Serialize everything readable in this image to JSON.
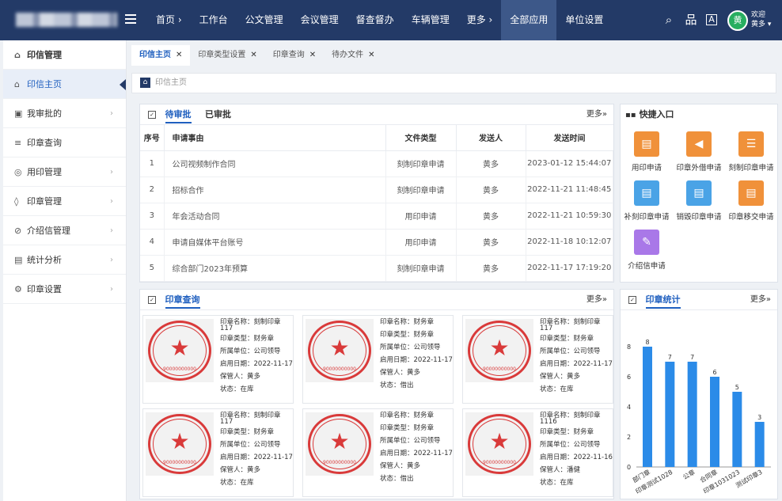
{
  "header": {
    "nav": [
      "首页 ›",
      "工作台",
      "公文管理",
      "会议管理",
      "督查督办",
      "车辆管理",
      "更多 ›",
      "全部应用",
      "单位设置"
    ],
    "avatar": "黄",
    "welcome1": "欢迎",
    "welcome2": "黄多 ▾"
  },
  "sidebar": {
    "items": [
      {
        "label": "印信管理",
        "icon": "⌂"
      },
      {
        "label": "印信主页",
        "icon": "⌂"
      },
      {
        "label": "我审批的",
        "icon": "▣"
      },
      {
        "label": "印章查询",
        "icon": "≡"
      },
      {
        "label": "用印管理",
        "icon": "◎"
      },
      {
        "label": "印章管理",
        "icon": "◊"
      },
      {
        "label": "介绍信管理",
        "icon": "⊘"
      },
      {
        "label": "统计分析",
        "icon": "▤"
      },
      {
        "label": "印章设置",
        "icon": "⚙"
      }
    ]
  },
  "tabs": [
    {
      "label": "印信主页"
    },
    {
      "label": "印章类型设置"
    },
    {
      "label": "印章查询"
    },
    {
      "label": "待办文件"
    }
  ],
  "crumb": "印信主页",
  "approval": {
    "tab1": "待审批",
    "tab2": "已审批",
    "more": "更多»",
    "headers": [
      "序号",
      "申请事由",
      "文件类型",
      "发送人",
      "发送时间"
    ],
    "rows": [
      [
        "1",
        "公司视频制作合同",
        "刻制印章申请",
        "黄多",
        "2023-01-12 15:44:07"
      ],
      [
        "2",
        "招标合作",
        "刻制印章申请",
        "黄多",
        "2022-11-21 11:48:45"
      ],
      [
        "3",
        "年会活动合同",
        "用印申请",
        "黄多",
        "2022-11-21 10:59:30"
      ],
      [
        "4",
        "申请自媒体平台账号",
        "用印申请",
        "黄多",
        "2022-11-18 10:12:07"
      ],
      [
        "5",
        "综合部门2023年预算",
        "刻制印章申请",
        "黄多",
        "2022-11-17 17:19:20"
      ]
    ]
  },
  "quick": {
    "title": "快捷入口",
    "items": [
      "用印申请",
      "印章外借申请",
      "刻制印章申请",
      "补刻印章申请",
      "销毁印章申请",
      "印章移交申请",
      "介绍信申请"
    ],
    "colors": [
      "#f0913a",
      "#f0913a",
      "#f0913a",
      "#4aa3e6",
      "#4aa3e6",
      "#f0913a",
      "#a978e8"
    ]
  },
  "seals": {
    "title": "印章查询",
    "more": "更多»",
    "seal_text": "小北村第五节运动会组委会",
    "seal_num": "90000000000",
    "cards": [
      [
        "印章名称：刻制印章",
        "117",
        "印章类型：财务章",
        "所属单位：公司领导",
        "启用日期：2022-11-17",
        "保管人：黄多",
        "状态：在库"
      ],
      [
        "印章名称：财务章",
        "",
        "印章类型：财务章",
        "所属单位：公司领导",
        "启用日期：2022-11-17",
        "保管人：黄多",
        "状态：借出"
      ],
      [
        "印章名称：刻制印章",
        "117",
        "印章类型：财务章",
        "所属单位：公司领导",
        "启用日期：2022-11-17",
        "保管人：黄多",
        "状态：在库"
      ],
      [
        "印章名称：刻制印章",
        "117",
        "印章类型：财务章",
        "所属单位：公司领导",
        "启用日期：2022-11-17",
        "保管人：黄多",
        "状态：在库"
      ],
      [
        "印章名称：财务章",
        "",
        "印章类型：财务章",
        "所属单位：公司领导",
        "启用日期：2022-11-17",
        "保管人：黄多",
        "状态：借出"
      ],
      [
        "印章名称：刻制印章",
        "1116",
        "印章类型：财务章",
        "所属单位：公司领导",
        "启用日期：2022-11-16",
        "保管人：潘健",
        "状态：在库"
      ]
    ]
  },
  "stats": {
    "title": "印章统计",
    "more": "更多»"
  },
  "chart_data": {
    "type": "bar",
    "categories": [
      "部门章",
      "印章测试1028",
      "公章",
      "合同章",
      "印章1031023",
      "测试印章3"
    ],
    "values": [
      8,
      7,
      7,
      6,
      5,
      3
    ],
    "ylim": [
      0,
      8
    ],
    "yticks": [
      "0",
      "2",
      "4",
      "6",
      "8"
    ],
    "color": "#2b8be8"
  }
}
